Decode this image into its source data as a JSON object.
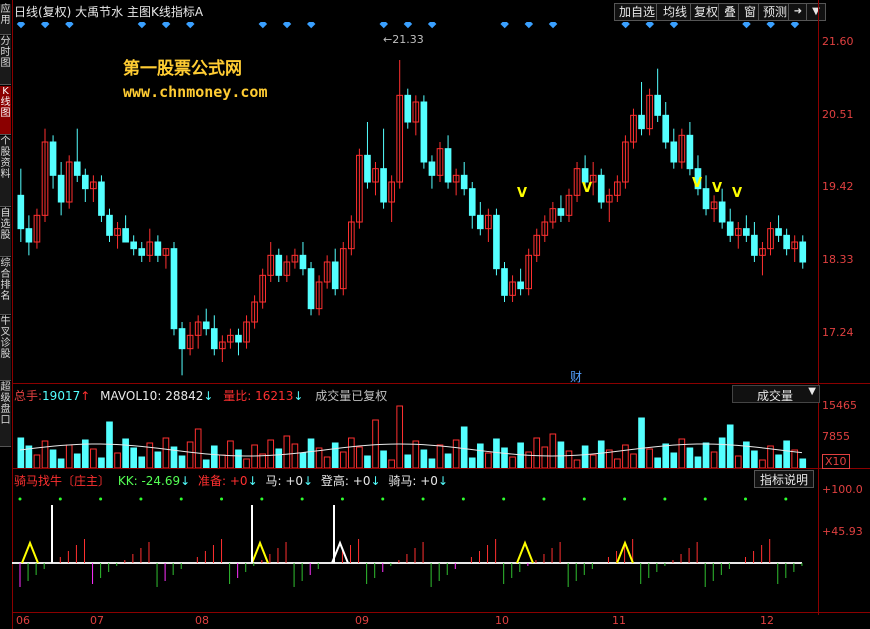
{
  "sidebar": {
    "tabs": [
      {
        "label": "应用",
        "active": false
      },
      {
        "label": "分时图",
        "active": false
      },
      {
        "label": "K线图",
        "active": true
      },
      {
        "label": "个股资料",
        "active": false
      },
      {
        "label": "自选股",
        "active": false
      },
      {
        "label": "综合排名",
        "active": false
      },
      {
        "label": "牛叉诊股",
        "active": false
      },
      {
        "label": "超级盘口",
        "active": false
      }
    ]
  },
  "header": {
    "title": "日线(复权)  大禹节水  主图K线指标A",
    "buttons": [
      "加自选",
      "均线",
      "复权",
      "叠",
      "窗",
      "预测"
    ],
    "arrow_btn": "➜",
    "menu_btn": "▼"
  },
  "main_chart": {
    "watermark_cn": "第一股票公式网",
    "watermark_url": "www.chnmoney.com",
    "high_marker": "←21.33",
    "finance_marker": "财",
    "price_ticks": [
      "21.60",
      "20.51",
      "19.42",
      "18.33",
      "17.24"
    ]
  },
  "volume_panel": {
    "total_label": "总手:",
    "total_value": "19017",
    "mavol_label": "MAVOL10:",
    "mavol_value": "28842",
    "ratio_label": "量比:",
    "ratio_value": "16213",
    "note": "成交量已复权",
    "selector": "成交量",
    "ticks": [
      "15465",
      "7855",
      "X10"
    ]
  },
  "indicator_panel": {
    "name": "骑马找牛〔庄主〕",
    "kk": "KK: -24.69",
    "zb": "准备: +0",
    "ma": "马: +0",
    "dg": "登高: +0",
    "qm": "骑马: +0",
    "help": "指标说明",
    "ticks": [
      "+100.0",
      "+45.93"
    ]
  },
  "x_axis": [
    "06",
    "07",
    "08",
    "09",
    "10",
    "11",
    "12"
  ],
  "colors": {
    "up": "#ff3030",
    "down": "#54ffff",
    "axis": "#e04040",
    "grid": "#8b0000",
    "yellow": "#ffff00"
  },
  "chart_data": {
    "type": "candlestick",
    "ylim": [
      16.5,
      21.9
    ],
    "candles": [
      [
        19.3,
        19.7,
        18.6,
        18.8
      ],
      [
        18.8,
        19.0,
        18.4,
        18.6
      ],
      [
        18.6,
        19.1,
        18.5,
        19.0
      ],
      [
        19.0,
        20.3,
        18.9,
        20.1
      ],
      [
        20.1,
        20.2,
        19.4,
        19.6
      ],
      [
        19.6,
        19.8,
        19.0,
        19.2
      ],
      [
        19.2,
        19.9,
        19.1,
        19.8
      ],
      [
        19.8,
        20.3,
        19.5,
        19.6
      ],
      [
        19.6,
        19.7,
        19.2,
        19.4
      ],
      [
        19.4,
        19.6,
        19.2,
        19.5
      ],
      [
        19.5,
        19.6,
        18.9,
        19.0
      ],
      [
        19.0,
        19.1,
        18.6,
        18.7
      ],
      [
        18.7,
        18.9,
        18.5,
        18.8
      ],
      [
        18.8,
        19.0,
        18.6,
        18.6
      ],
      [
        18.6,
        18.7,
        18.4,
        18.5
      ],
      [
        18.5,
        18.6,
        18.3,
        18.4
      ],
      [
        18.4,
        18.8,
        18.3,
        18.6
      ],
      [
        18.6,
        18.7,
        18.3,
        18.4
      ],
      [
        18.4,
        18.5,
        18.2,
        18.5
      ],
      [
        18.5,
        18.6,
        17.2,
        17.3
      ],
      [
        17.3,
        17.4,
        16.6,
        17.0
      ],
      [
        17.0,
        17.4,
        16.9,
        17.2
      ],
      [
        17.2,
        17.5,
        17.0,
        17.4
      ],
      [
        17.4,
        17.6,
        17.2,
        17.3
      ],
      [
        17.3,
        17.5,
        16.9,
        17.0
      ],
      [
        17.0,
        17.2,
        16.8,
        17.1
      ],
      [
        17.1,
        17.3,
        17.0,
        17.2
      ],
      [
        17.2,
        17.3,
        16.9,
        17.1
      ],
      [
        17.1,
        17.5,
        17.0,
        17.4
      ],
      [
        17.4,
        17.8,
        17.3,
        17.7
      ],
      [
        17.7,
        18.2,
        17.6,
        18.1
      ],
      [
        18.1,
        18.6,
        18.0,
        18.4
      ],
      [
        18.4,
        18.5,
        18.0,
        18.1
      ],
      [
        18.1,
        18.4,
        18.0,
        18.3
      ],
      [
        18.3,
        18.5,
        18.2,
        18.4
      ],
      [
        18.4,
        18.6,
        18.1,
        18.2
      ],
      [
        18.2,
        18.3,
        17.5,
        17.6
      ],
      [
        17.6,
        18.1,
        17.5,
        18.0
      ],
      [
        18.0,
        18.4,
        17.9,
        18.3
      ],
      [
        18.3,
        18.5,
        17.8,
        17.9
      ],
      [
        17.9,
        18.6,
        17.8,
        18.5
      ],
      [
        18.5,
        19.0,
        18.4,
        18.9
      ],
      [
        18.9,
        20.0,
        18.8,
        19.9
      ],
      [
        19.9,
        20.4,
        19.4,
        19.5
      ],
      [
        19.5,
        19.8,
        19.3,
        19.7
      ],
      [
        19.7,
        20.3,
        19.1,
        19.2
      ],
      [
        19.2,
        19.6,
        18.9,
        19.5
      ],
      [
        19.5,
        21.33,
        19.4,
        20.8
      ],
      [
        20.8,
        20.9,
        20.3,
        20.4
      ],
      [
        20.4,
        20.8,
        20.2,
        20.7
      ],
      [
        20.7,
        20.8,
        19.7,
        19.8
      ],
      [
        19.8,
        19.9,
        19.4,
        19.6
      ],
      [
        19.6,
        20.1,
        19.5,
        20.0
      ],
      [
        20.0,
        20.2,
        19.4,
        19.5
      ],
      [
        19.5,
        19.7,
        19.3,
        19.6
      ],
      [
        19.6,
        19.8,
        19.3,
        19.4
      ],
      [
        19.4,
        19.5,
        18.8,
        19.0
      ],
      [
        19.0,
        19.2,
        18.7,
        18.8
      ],
      [
        18.8,
        19.1,
        18.6,
        19.0
      ],
      [
        19.0,
        19.1,
        18.1,
        18.2
      ],
      [
        18.2,
        18.3,
        17.7,
        17.8
      ],
      [
        17.8,
        18.1,
        17.7,
        18.0
      ],
      [
        18.0,
        18.2,
        17.8,
        17.9
      ],
      [
        17.9,
        18.5,
        17.8,
        18.4
      ],
      [
        18.4,
        18.8,
        18.3,
        18.7
      ],
      [
        18.7,
        19.0,
        18.6,
        18.9
      ],
      [
        18.9,
        19.2,
        18.8,
        19.1
      ],
      [
        19.1,
        19.3,
        18.9,
        19.0
      ],
      [
        19.0,
        19.4,
        18.9,
        19.3
      ],
      [
        19.3,
        19.8,
        19.2,
        19.7
      ],
      [
        19.7,
        19.9,
        19.4,
        19.5
      ],
      [
        19.5,
        19.8,
        19.3,
        19.6
      ],
      [
        19.6,
        19.7,
        19.1,
        19.2
      ],
      [
        19.2,
        19.4,
        18.9,
        19.3
      ],
      [
        19.3,
        19.6,
        19.2,
        19.5
      ],
      [
        19.5,
        20.2,
        19.4,
        20.1
      ],
      [
        20.1,
        20.6,
        20.0,
        20.5
      ],
      [
        20.5,
        21.0,
        20.2,
        20.3
      ],
      [
        20.3,
        20.9,
        20.2,
        20.8
      ],
      [
        20.8,
        21.2,
        20.4,
        20.5
      ],
      [
        20.5,
        20.7,
        20.0,
        20.1
      ],
      [
        20.1,
        20.3,
        19.7,
        19.8
      ],
      [
        19.8,
        20.3,
        19.7,
        20.2
      ],
      [
        20.2,
        20.4,
        19.6,
        19.7
      ],
      [
        19.7,
        19.9,
        19.3,
        19.4
      ],
      [
        19.4,
        19.6,
        19.0,
        19.1
      ],
      [
        19.1,
        19.3,
        18.9,
        19.2
      ],
      [
        19.2,
        19.4,
        18.8,
        18.9
      ],
      [
        18.9,
        19.1,
        18.6,
        18.7
      ],
      [
        18.7,
        18.9,
        18.5,
        18.8
      ],
      [
        18.8,
        19.0,
        18.6,
        18.7
      ],
      [
        18.7,
        18.9,
        18.3,
        18.4
      ],
      [
        18.4,
        18.6,
        18.1,
        18.5
      ],
      [
        18.5,
        18.9,
        18.4,
        18.8
      ],
      [
        18.8,
        19.0,
        18.6,
        18.7
      ],
      [
        18.7,
        18.8,
        18.4,
        18.5
      ],
      [
        18.5,
        18.7,
        18.3,
        18.6
      ],
      [
        18.6,
        18.7,
        18.2,
        18.3
      ]
    ]
  }
}
